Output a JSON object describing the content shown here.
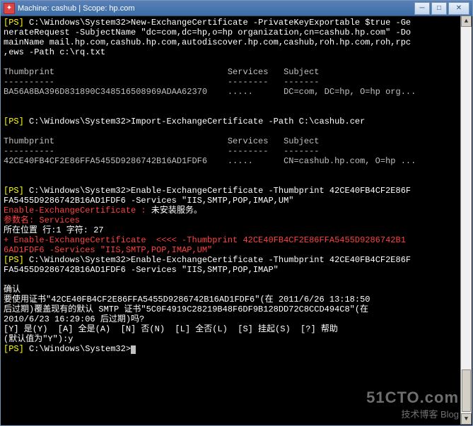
{
  "title": "Machine: cashub | Scope: hp.com",
  "prompt_prefix": "[PS]",
  "prompt_path": "C:\\Windows\\System32>",
  "lines": [
    {
      "type": "cmd",
      "text": "New-ExchangeCertificate -PrivateKeyExportable $true -Ge"
    },
    {
      "type": "cont",
      "text": "nerateRequest -SubjectName \"dc=com,dc=hp,o=hp organization,cn=cashub.hp.com\" -Do"
    },
    {
      "type": "cont",
      "text": "mainName mail.hp.com,cashub.hp.com,autodiscover.hp.com,cashub,roh.hp.com,roh,rpc"
    },
    {
      "type": "cont",
      "text": ",ews -Path c:\\rq.txt"
    },
    {
      "type": "blank"
    },
    {
      "type": "hdr",
      "c1": "Thumbprint",
      "c2": "Services",
      "c3": "Subject"
    },
    {
      "type": "hdr",
      "c1": "----------",
      "c2": "--------",
      "c3": "-------"
    },
    {
      "type": "row",
      "c1": "BA56A8BA396D831890C348516508969ADAA62370",
      "c2": ".....",
      "c3": "DC=com, DC=hp, O=hp org..."
    },
    {
      "type": "blank"
    },
    {
      "type": "blank"
    },
    {
      "type": "cmd",
      "text": "Import-ExchangeCertificate -Path C:\\cashub.cer"
    },
    {
      "type": "blank"
    },
    {
      "type": "hdr",
      "c1": "Thumbprint",
      "c2": "Services",
      "c3": "Subject"
    },
    {
      "type": "hdr",
      "c1": "----------",
      "c2": "--------",
      "c3": "-------"
    },
    {
      "type": "row",
      "c1": "42CE40FB4CF2E86FFA5455D9286742B16AD1FDF6",
      "c2": ".....",
      "c3": "CN=cashub.hp.com, O=hp ..."
    },
    {
      "type": "blank"
    },
    {
      "type": "blank"
    },
    {
      "type": "cmd",
      "text": "Enable-ExchangeCertificate -Thumbprint 42CE40FB4CF2E86F"
    },
    {
      "type": "cont",
      "text": "FA5455D9286742B16AD1FDF6 -Services \"IIS,SMTP,POP,IMAP,UM\""
    },
    {
      "type": "redwhite",
      "r": "Enable-ExchangeCertificate : ",
      "w": "未安装服务。"
    },
    {
      "type": "redonly",
      "r": "参数名: Services"
    },
    {
      "type": "whiteonly",
      "w": "所在位置 行:1 字符: 27"
    },
    {
      "type": "redonly",
      "r": "+ Enable-ExchangeCertificate  <<<< -Thumbprint 42CE40FB4CF2E86FFA5455D9286742B1"
    },
    {
      "type": "redonly",
      "r": "6AD1FDF6 -Services \"IIS,SMTP,POP,IMAP,UM\""
    },
    {
      "type": "cmd",
      "text": "Enable-ExchangeCertificate -Thumbprint 42CE40FB4CF2E86F"
    },
    {
      "type": "cont",
      "text": "FA5455D9286742B16AD1FDF6 -Services \"IIS,SMTP,POP,IMAP\""
    },
    {
      "type": "blank"
    },
    {
      "type": "whiteonly",
      "w": "确认"
    },
    {
      "type": "whiteonly",
      "w": "要使用证书\"42CE40FB4CF2E86FFA5455D9286742B16AD1FDF6\"(在 2011/6/26 13:18:50"
    },
    {
      "type": "whiteonly",
      "w": "后过期)覆盖现有的默认 SMTP 证书\"5C0F4919C28219B48F6DF9B128DD72C8CCD494C8\"(在"
    },
    {
      "type": "whiteonly",
      "w": "2010/6/23 16:29:06 后过期)吗?"
    },
    {
      "type": "whiteonly",
      "w": "[Y] 是(Y)  [A] 全是(A)  [N] 否(N)  [L] 全否(L)  [S] 挂起(S)  [?] 帮助"
    },
    {
      "type": "whiteonly",
      "w": "(默认值为\"Y\"):y"
    },
    {
      "type": "cmd",
      "text": ""
    }
  ],
  "watermark": {
    "line1": "51CTO.com",
    "line2": "技术博客  Blog"
  },
  "buttons": {
    "minimize": "─",
    "maximize": "□",
    "close": "✕"
  },
  "scroll": {
    "up": "▲",
    "down": "▼"
  }
}
